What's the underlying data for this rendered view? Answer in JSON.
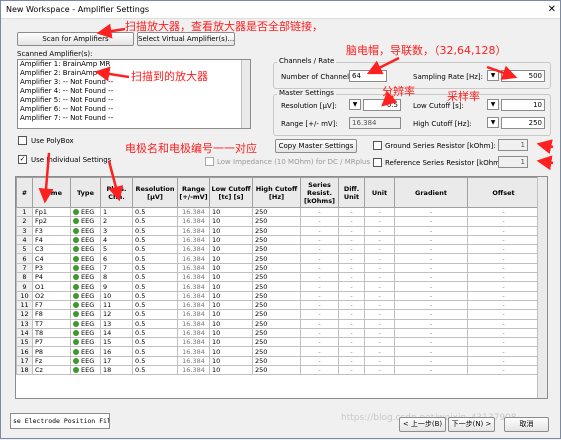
{
  "window": {
    "title": "New Workspace - Amplifier Settings",
    "close_glyph": "✕"
  },
  "buttons": {
    "scan": "Scan for Amplifiers",
    "select_virtual": "Select Virtual Amplifier(s)...",
    "copy_master": "Copy Master Settings",
    "back": "< 上一步(B)",
    "next": "下一步(N) >",
    "cancel": "取消"
  },
  "scanned_label": "Scanned Amplifier(s):",
  "amplifiers": [
    "Amplifier 1: BrainAmp MR",
    "Amplifier 2: BrainAmp MR",
    "Amplifier 3: -- Not Found --",
    "Amplifier 4: -- Not Found --",
    "Amplifier 5: -- Not Found --",
    "Amplifier 6: -- Not Found --",
    "Amplifier 7: -- Not Found --"
  ],
  "channels_rate": {
    "group": "Channels / Rate",
    "num_channels_label": "Number of Channels:",
    "num_channels": "64",
    "sampling_rate_label": "Sampling Rate [Hz]:",
    "sampling_rate": "500"
  },
  "master": {
    "group": "Master Settings",
    "resolution_label": "Resolution [µV]:",
    "resolution": "0.5",
    "low_cutoff_label": "Low Cutoff [s]:",
    "low_cutoff": "10",
    "range_label": "Range [+/- mV]:",
    "range": "16.384",
    "high_cutoff_label": "High Cutoff [Hz]:",
    "high_cutoff": "250"
  },
  "options": {
    "use_polybox": "Use PolyBox",
    "use_individual": "Use Individual Settings",
    "low_impedance": "Low Impedance (10 MOhm) for DC / MRplus",
    "ground_resistor": "Ground Series Resistor [kOhm]:",
    "ground_value": "1",
    "reference_resistor": "Reference Series Resistor [kOhm]:",
    "reference_value": "1"
  },
  "table": {
    "headers": [
      "#",
      "Name",
      "Type",
      "Phys. Chn.",
      "Resolution [µV]",
      "Range [+/-mV]",
      "Low Cutoff [tc] [s]",
      "High Cutoff [Hz]",
      "Series Resist. [kOhms]",
      "Diff. Unit",
      "Unit",
      "Gradient",
      "Offset"
    ],
    "type_label": "EEG",
    "resolution": "0.5",
    "range": "16.384",
    "low_cutoff": "10",
    "high_cutoff": "250",
    "series": "-",
    "diff": "-",
    "unit": "-",
    "gradient": "-",
    "offset": "-",
    "rows": [
      {
        "n": "1",
        "name": "Fp1",
        "chn": "1"
      },
      {
        "n": "2",
        "name": "Fp2",
        "chn": "2"
      },
      {
        "n": "3",
        "name": "F3",
        "chn": "3"
      },
      {
        "n": "4",
        "name": "F4",
        "chn": "4"
      },
      {
        "n": "5",
        "name": "C3",
        "chn": "5"
      },
      {
        "n": "6",
        "name": "C4",
        "chn": "6"
      },
      {
        "n": "7",
        "name": "P3",
        "chn": "7"
      },
      {
        "n": "8",
        "name": "P4",
        "chn": "8"
      },
      {
        "n": "9",
        "name": "O1",
        "chn": "9"
      },
      {
        "n": "10",
        "name": "O2",
        "chn": "10"
      },
      {
        "n": "11",
        "name": "F7",
        "chn": "11"
      },
      {
        "n": "12",
        "name": "F8",
        "chn": "12"
      },
      {
        "n": "13",
        "name": "T7",
        "chn": "13"
      },
      {
        "n": "14",
        "name": "T8",
        "chn": "14"
      },
      {
        "n": "15",
        "name": "P7",
        "chn": "15"
      },
      {
        "n": "16",
        "name": "P8",
        "chn": "16"
      },
      {
        "n": "17",
        "name": "Fz",
        "chn": "17"
      },
      {
        "n": "18",
        "name": "Cz",
        "chn": "18"
      }
    ]
  },
  "status_text": "se Electrode Position Fil",
  "watermark": "https://blog.csdn.net/weixin_43137908",
  "annotations": {
    "scan": "扫描放大器，查看放大器是否全部链接，",
    "scanned": "扫描到的放大器",
    "channels": "脑电帽，导联数，（32,64,128）",
    "resolution": "分辨率",
    "sampling": "采样率",
    "electrode": "电极名和电极编号一一对应"
  },
  "colors": {
    "annotation": "#ff2020",
    "eeg_icon": "#3c9a2a"
  }
}
